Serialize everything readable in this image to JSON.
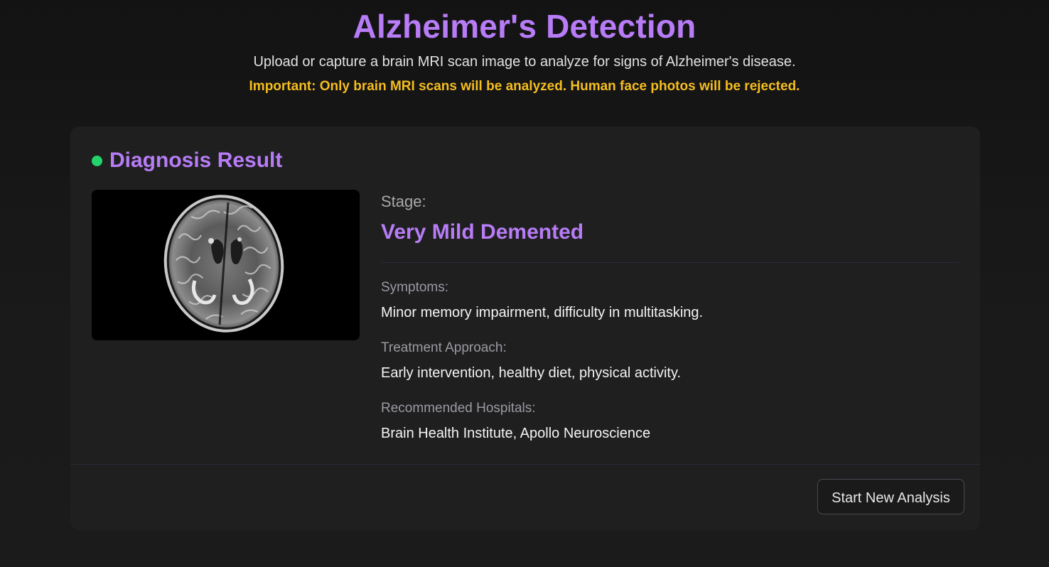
{
  "header": {
    "title": "Alzheimer's Detection",
    "subtitle": "Upload or capture a brain MRI scan image to analyze for signs of Alzheimer's disease.",
    "warning": "Important: Only brain MRI scans will be analyzed. Human face photos will be rejected."
  },
  "result": {
    "title": "Diagnosis Result",
    "status_color": "#22d46a",
    "stage_label": "Stage:",
    "stage_value": "Very Mild Demented",
    "symptoms_label": "Symptoms:",
    "symptoms_value": "Minor memory impairment, difficulty in multitasking.",
    "treatment_label": "Treatment Approach:",
    "treatment_value": "Early intervention, healthy diet, physical activity.",
    "hospitals_label": "Recommended Hospitals:",
    "hospitals_value": "Brain Health Institute, Apollo Neuroscience"
  },
  "actions": {
    "new_analysis_label": "Start New Analysis"
  },
  "colors": {
    "accent": "#b77cf6",
    "warning": "#f5bd1f",
    "background": "#181818",
    "card": "#1f1f1f"
  }
}
